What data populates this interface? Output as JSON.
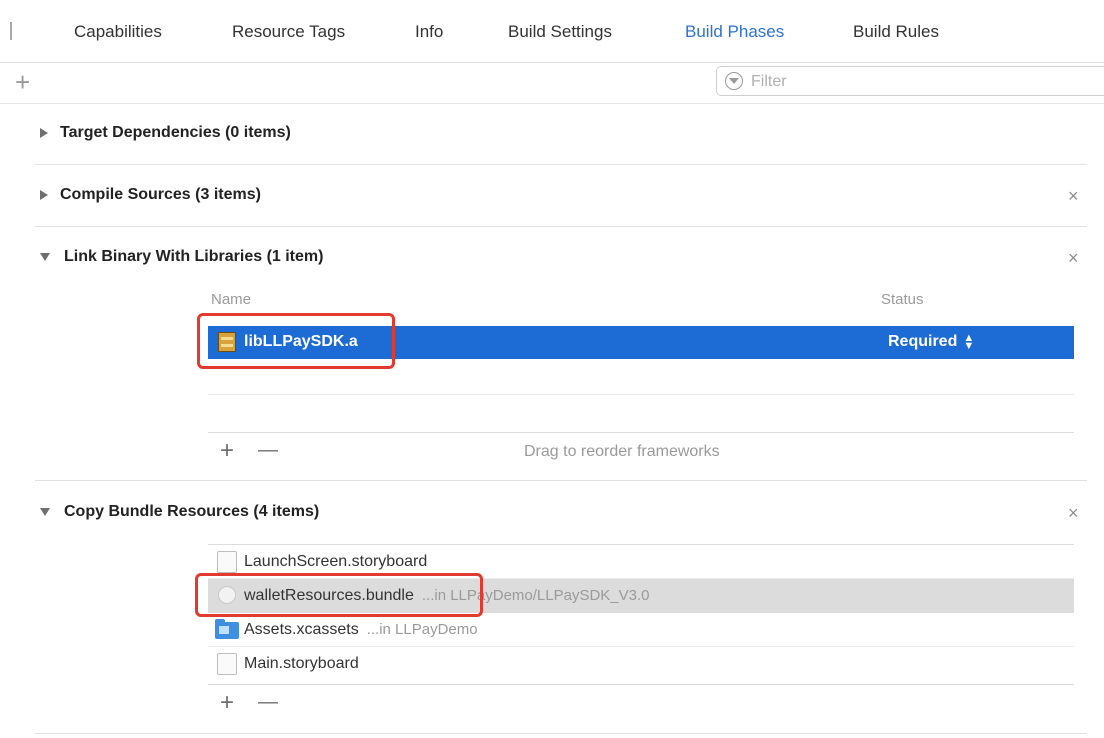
{
  "tabs": [
    {
      "label": "Capabilities",
      "active": false
    },
    {
      "label": "Resource Tags",
      "active": false
    },
    {
      "label": "Info",
      "active": false
    },
    {
      "label": "Build Settings",
      "active": false
    },
    {
      "label": "Build Phases",
      "active": true
    },
    {
      "label": "Build Rules",
      "active": false
    }
  ],
  "toolbar": {
    "add_symbol": "+",
    "filter_placeholder": "Filter"
  },
  "sections": {
    "target_dependencies": {
      "title": "Target Dependencies (0 items)",
      "expanded": false
    },
    "compile_sources": {
      "title": "Compile Sources (3 items)",
      "expanded": false,
      "close_symbol": "×"
    },
    "link_binary": {
      "title": "Link Binary With Libraries (1 item)",
      "expanded": true,
      "close_symbol": "×",
      "columns": {
        "name": "Name",
        "status": "Status"
      },
      "items": [
        {
          "name": "libLLPaySDK.a",
          "status": "Required",
          "selected": true
        }
      ],
      "footer": {
        "add_symbol": "+",
        "remove_symbol": "—",
        "hint": "Drag to reorder frameworks"
      }
    },
    "copy_bundle": {
      "title": "Copy Bundle Resources (4 items)",
      "expanded": true,
      "close_symbol": "×",
      "items": [
        {
          "name": "LaunchScreen.storyboard",
          "location": "",
          "icon": "document-icon"
        },
        {
          "name": "walletResources.bundle",
          "location": "...in LLPayDemo/LLPaySDK_V3.0",
          "icon": "bundle-icon",
          "highlighted": true
        },
        {
          "name": "Assets.xcassets",
          "location": "...in LLPayDemo",
          "icon": "folder-icon"
        },
        {
          "name": "Main.storyboard",
          "location": "",
          "icon": "document-icon"
        }
      ],
      "footer": {
        "add_symbol": "+",
        "remove_symbol": "—"
      }
    }
  },
  "colors": {
    "accent": "#2d73d6",
    "selection": "#1d6cd6",
    "highlight_row": "#dcdcdc",
    "callout": "#e23a2e"
  }
}
